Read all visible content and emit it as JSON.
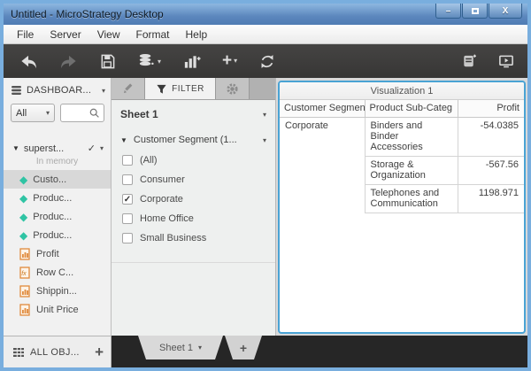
{
  "window": {
    "title": "Untitled - MicroStrategy Desktop",
    "controls": {
      "minimize": "–",
      "close": "X"
    }
  },
  "menu": {
    "items": [
      {
        "label": "File"
      },
      {
        "label": "Server"
      },
      {
        "label": "View"
      },
      {
        "label": "Format"
      },
      {
        "label": "Help"
      }
    ]
  },
  "icons": {
    "caret_down": "▾",
    "expander_open": "▼",
    "check": "✓",
    "plus": "+",
    "play": "▶"
  },
  "colors": {
    "titlebar_blue": "#5c87bd",
    "toolbar_dark": "#3b3a39",
    "attribute_teal": "#2fc4a4",
    "metric_orange": "#e08a3c",
    "selection_blue": "#4aa3d4"
  },
  "sidebar": {
    "header_label": "DASHBOAR...",
    "all_dropdown_value": "All",
    "dataset": {
      "name": "superst...",
      "status": "In memory"
    },
    "fields": [
      {
        "label": "Custo...",
        "type": "attribute",
        "selected": true
      },
      {
        "label": "Produc...",
        "type": "attribute",
        "selected": false
      },
      {
        "label": "Produc...",
        "type": "attribute",
        "selected": false
      },
      {
        "label": "Produc...",
        "type": "attribute",
        "selected": false
      },
      {
        "label": "Profit",
        "type": "metric",
        "selected": false
      },
      {
        "label": "Row C...",
        "type": "function",
        "selected": false
      },
      {
        "label": "Shippin...",
        "type": "metric",
        "selected": false
      },
      {
        "label": "Unit Price",
        "type": "metric",
        "selected": false
      }
    ],
    "footer": {
      "label": "ALL OBJ...",
      "add_label": "+"
    }
  },
  "filter_panel": {
    "tabs": [
      {
        "name": "edit",
        "label": ""
      },
      {
        "name": "filter",
        "label": "FILTER",
        "active": true
      },
      {
        "name": "settings",
        "label": ""
      }
    ],
    "sheet_selector": "Sheet 1",
    "group_label": "Customer Segment (1...",
    "options": [
      {
        "label": "(All)",
        "checked": false,
        "mark": ""
      },
      {
        "label": "Consumer",
        "checked": false,
        "mark": ""
      },
      {
        "label": "Corporate",
        "checked": true,
        "mark": "✓"
      },
      {
        "label": "Home Office",
        "checked": false,
        "mark": ""
      },
      {
        "label": "Small Business",
        "checked": false,
        "mark": ""
      }
    ]
  },
  "visualization": {
    "title": "Visualization 1",
    "table": {
      "columns": [
        "Customer Segment",
        "Product Sub-Categ",
        "Profit"
      ],
      "rows": [
        {
          "segment": "Corporate",
          "subcategory": "Binders and Binder Accessories",
          "profit": "-54.0385"
        },
        {
          "segment": "",
          "subcategory": "Storage & Organization",
          "profit": "-567.56"
        },
        {
          "segment": "",
          "subcategory": "Telephones and Communication",
          "profit": "1198.971"
        }
      ]
    }
  },
  "bottom_tabs": {
    "sheet_label": "Sheet 1",
    "add_label": "+"
  }
}
